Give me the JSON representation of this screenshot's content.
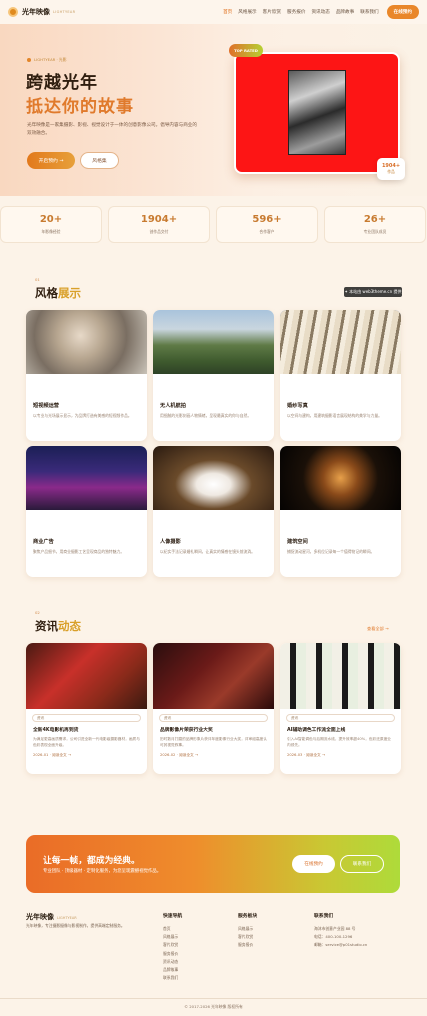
{
  "nav": {
    "brand": "光年映像",
    "brand_sub": "LIGHTYEAR",
    "items": [
      "首页",
      "风格展示",
      "客片欣赏",
      "服务报价",
      "资讯动态",
      "品牌故事",
      "联系我们"
    ],
    "cta": "在线预约"
  },
  "hero": {
    "tag": "LIGHTYEAR · 光影",
    "title_line1": "跨越光年",
    "title_line2": "抵达你的故事",
    "desc": "光年映像是一家集摄影、影视、视觉设计于一体的创意影像公司。倡导内容与商业的双效融合。",
    "btn_primary": "开启预约 →",
    "btn_secondary": "风格集",
    "top_rated": "TOP RATED",
    "badge_num": "1904+",
    "badge_label": "作品"
  },
  "stats": [
    {
      "num": "20+",
      "label": "年影像经验"
    },
    {
      "num": "1904+",
      "label": "创作品交付"
    },
    {
      "num": "596+",
      "label": "合作客户"
    },
    {
      "num": "26+",
      "label": "专业团队成员"
    }
  ],
  "styles": {
    "no": "01",
    "title": "风格",
    "title_em": "展示",
    "watermark": "✦ 本站由 web3theme.cn 提供",
    "cards": [
      {
        "title": "短视频运营",
        "desc": "以专业与光场展示显示，为品牌打造有美感的短视频作品。"
      },
      {
        "title": "无人机航拍",
        "desc": "用细腻的光影刻画人物情绪，呈现最真实的你与自然。"
      },
      {
        "title": "婚纱写真",
        "desc": "以空间与建构，用建筑摄影语言展现结构的美学与力量。"
      },
      {
        "title": "商业广告",
        "desc": "聚焦产品细节，用商业摄影工艺呈现商品的独特魅力。"
      },
      {
        "title": "人像摄影",
        "desc": "以纪实手法记录婚礼瞬间，让真实的情感在镜头前流淌。"
      },
      {
        "title": "建筑空间",
        "desc": "捕捉流动星河，多机位记录每一个值得铭记的瞬间。"
      }
    ]
  },
  "news": {
    "no": "02",
    "title": "资讯",
    "title_em": "动态",
    "more": "查看全部 →",
    "items": [
      {
        "tag": "资讯",
        "title": "全新4K电影机再到货",
        "desc": "为满足更高画质需求，公司引进全新一代电影级摄影器材，画质与色彩表现全面升级。",
        "date": "2026-01",
        "link": "阅读全文 →"
      },
      {
        "tag": "资讯",
        "title": "品牌影像片荣获行业大奖",
        "desc": "历时数月打磨的品牌形象片获评年度影像行业大奖，评审组高度认可其视觉叙事。",
        "date": "2026-02",
        "link": "阅读全文 →"
      },
      {
        "tag": "资讯",
        "title": "AI辅助调色工作流全面上线",
        "desc": "引入AI智能调色与后期流水线，提升效率超40%，色彩还原度业内领先。",
        "date": "2026-03",
        "link": "阅读全文 →"
      }
    ]
  },
  "cta": {
    "title": "让每一帧，都成为经典。",
    "sub": "专业团队 · 顶级器材 · 定制化服务，为您呈现震撼视觉作品。",
    "btn1": "在线预约",
    "btn2": "联系我们"
  },
  "footer": {
    "brand": "光年映像",
    "brand_sub": "LIGHTYEAR",
    "desc": "光年映像，专注摄影摄像与影视制作，提供高端定制服务。",
    "col1_title": "快速导航",
    "col1": [
      "首页",
      "风格展示",
      "客片欣赏",
      "服务报价",
      "资讯动态",
      "品牌故事",
      "联系我们"
    ],
    "col2_title": "服务板块",
    "col2": [
      "风格展示",
      "客片欣赏",
      "服务报价"
    ],
    "col3_title": "联系我们",
    "col3": [
      "海沐市创意产业园 88 号",
      "电话：400-100-1296",
      "邮箱：service@p01studio.cn"
    ],
    "copyright": "© 2017-2026 光年映像 版权所有"
  }
}
